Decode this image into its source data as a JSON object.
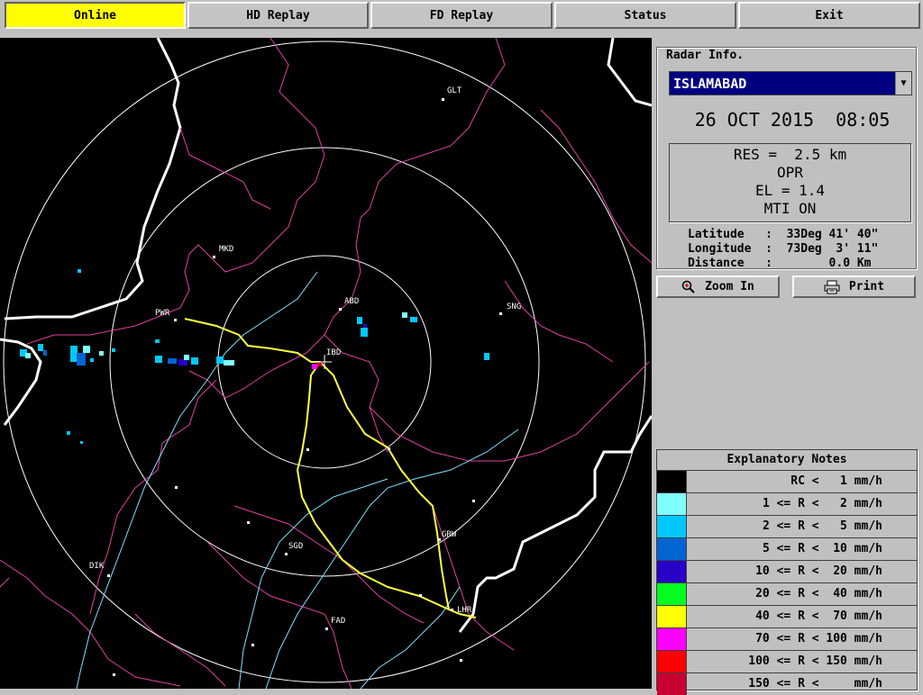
{
  "topbar": {
    "online": "Online",
    "hd_replay": "HD Replay",
    "fd_replay": "FD Replay",
    "status": "Status",
    "exit": "Exit"
  },
  "radar_info": {
    "legend": "Radar Info.",
    "station": "ISLAMABAD",
    "date": "26 OCT 2015",
    "time": "08:05",
    "res": "RES =  2.5 km",
    "mode": "OPR",
    "elevation": "EL = 1.4",
    "mti": "MTI ON",
    "latitude_label": "Latitude",
    "latitude_value": "33Deg 41' 40\"",
    "longitude_label": "Longitude",
    "longitude_value": "73Deg  3' 11\"",
    "distance_label": "Distance",
    "distance_value": "0.0 Km"
  },
  "buttons": {
    "zoom_in": "Zoom In",
    "print": "Print"
  },
  "notes": {
    "title": "Explanatory Notes",
    "rows": [
      {
        "color": "#000000",
        "text": "RC <   1 mm/h"
      },
      {
        "color": "#80ffff",
        "text": "1 <= R <   2 mm/h"
      },
      {
        "color": "#00c8ff",
        "text": "2 <= R <   5 mm/h"
      },
      {
        "color": "#0064d2",
        "text": "5 <= R <  10 mm/h"
      },
      {
        "color": "#2800c8",
        "text": "10 <= R <  20 mm/h"
      },
      {
        "color": "#00ff20",
        "text": "20 <= R <  40 mm/h"
      },
      {
        "color": "#ffff00",
        "text": "40 <= R <  70 mm/h"
      },
      {
        "color": "#ff00ff",
        "text": "70 <= R < 100 mm/h"
      },
      {
        "color": "#ff0000",
        "text": "100 <= R < 150 mm/h"
      },
      {
        "color": "#c80032",
        "text": "150 <= R <     mm/h"
      }
    ]
  },
  "map": {
    "places": [
      "GLT",
      "MKD",
      "ABD",
      "PWR",
      "IBD",
      "SNG",
      "DIK",
      "SGD",
      "GRW",
      "LHR",
      "FAD"
    ]
  },
  "colors": {
    "active_button": "#ffff00",
    "station_bg": "#000080",
    "map_bg": "#000000",
    "border_line": "#ffffff",
    "district_line": "#e040a0",
    "river_line": "#80e0ff",
    "road_line": "#ffff40"
  }
}
